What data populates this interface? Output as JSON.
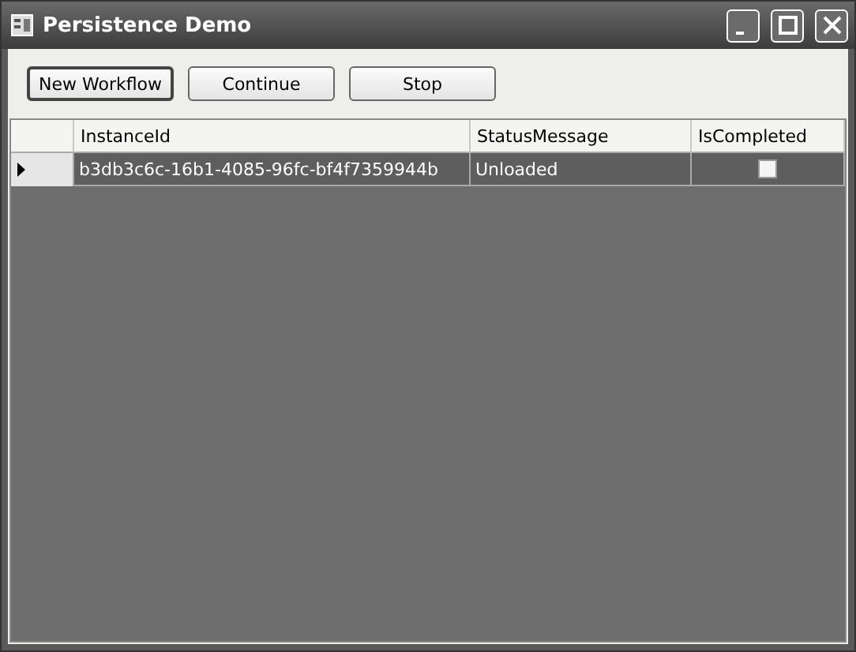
{
  "window": {
    "title": "Persistence Demo"
  },
  "buttons": [
    {
      "label": "New Workflow",
      "focused": true
    },
    {
      "label": "Continue",
      "focused": false
    },
    {
      "label": "Stop",
      "focused": false
    }
  ],
  "grid": {
    "columns": [
      "InstanceId",
      "StatusMessage",
      "IsCompleted"
    ],
    "rows": [
      {
        "instance_id": "b3db3c6c-16b1-4085-96fc-bf4f7359944b",
        "status_message": "Unloaded",
        "is_completed": false,
        "selected": true
      }
    ]
  }
}
